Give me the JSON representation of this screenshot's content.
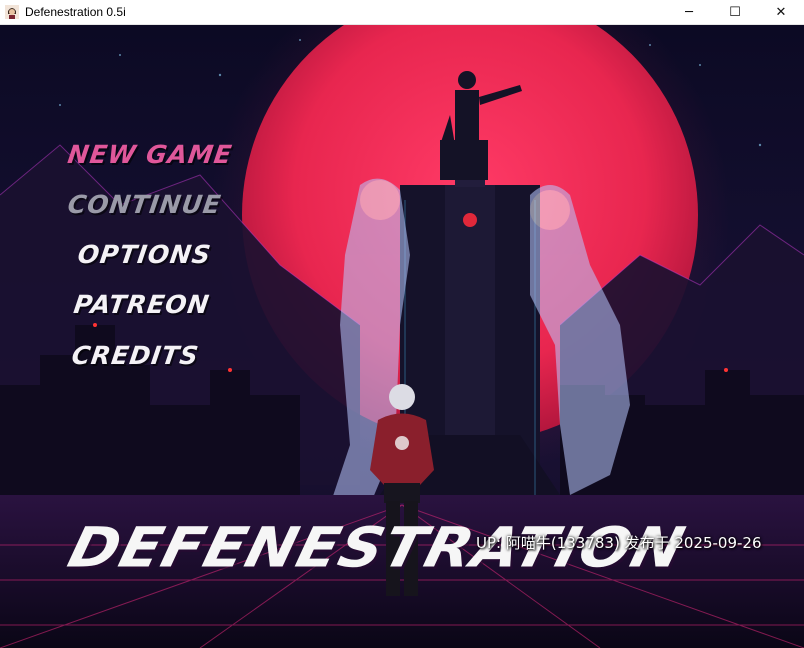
{
  "window": {
    "title": "Defenestration 0.5i",
    "app_icon": "character-portrait-icon",
    "controls": {
      "minimize": "─",
      "maximize": "☐",
      "close": "✕"
    }
  },
  "menu": {
    "items": [
      {
        "label": "NEW GAME",
        "state": "hover"
      },
      {
        "label": "CONTINUE",
        "state": "disabled"
      },
      {
        "label": "OPTIONS",
        "state": "normal"
      },
      {
        "label": "PATREON",
        "state": "normal"
      },
      {
        "label": "CREDITS",
        "state": "normal"
      }
    ]
  },
  "logo": {
    "text": "DEFENESTRATION"
  },
  "overlay": {
    "watermark": "UP: 阿喵牛(133783) 发布于 2025-09-26"
  },
  "colors": {
    "menu_highlight": "#e0579a",
    "menu_disabled": "#9a9aa8",
    "menu_normal": "#f4f2f6",
    "moon": "#e8264f",
    "sky": "#120e2c",
    "neon_grid": "#e0287a"
  }
}
